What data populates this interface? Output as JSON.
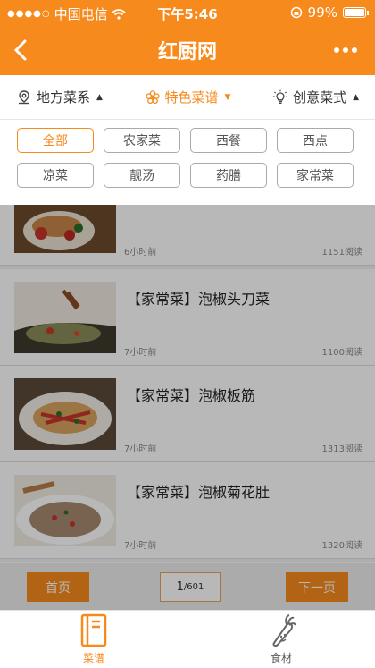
{
  "status": {
    "carrier": "中国电信",
    "time": "下午5:46",
    "battery": "99%",
    "battery_level": 0.99
  },
  "nav": {
    "title": "红厨网"
  },
  "categories": [
    {
      "label": "地方菜系",
      "icon": "location-pin-icon",
      "active": false
    },
    {
      "label": "特色菜谱",
      "icon": "flower-icon",
      "active": true
    },
    {
      "label": "创意菜式",
      "icon": "lightbulb-icon",
      "active": false
    }
  ],
  "filters": [
    "全部",
    "农家菜",
    "西餐",
    "西点",
    "凉菜",
    "靓汤",
    "药膳",
    "家常菜"
  ],
  "recipes": [
    {
      "title": "",
      "time": "6小时前",
      "reads": "1151阅读"
    },
    {
      "title": "【家常菜】泡椒头刀菜",
      "time": "7小时前",
      "reads": "1100阅读"
    },
    {
      "title": "【家常菜】泡椒板筋",
      "time": "7小时前",
      "reads": "1313阅读"
    },
    {
      "title": "【家常菜】泡椒菊花肚",
      "time": "7小时前",
      "reads": "1320阅读"
    }
  ],
  "pager": {
    "first": "首页",
    "current": "1",
    "total": "/601",
    "next": "下一页"
  },
  "tabs": [
    {
      "label": "菜谱",
      "icon": "recipe-book-icon",
      "active": true
    },
    {
      "label": "食材",
      "icon": "carrot-icon",
      "active": false
    }
  ],
  "colors": {
    "accent": "#f78a1d"
  }
}
